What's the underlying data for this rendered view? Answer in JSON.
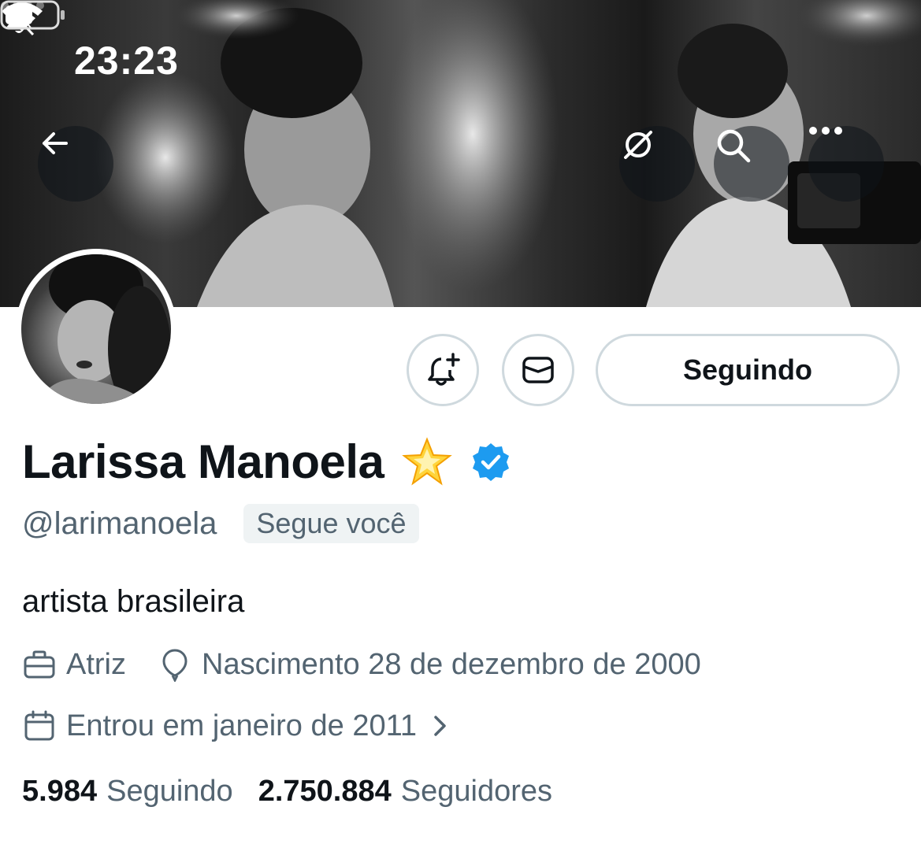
{
  "status_bar": {
    "time": "23:23",
    "icons": [
      "bell-muted-icon",
      "cellular-signal-icon",
      "wifi-icon",
      "battery-icon"
    ]
  },
  "nav": {
    "back_icon": "arrow-left-icon",
    "grok_icon": "grok-icon",
    "search_icon": "search-icon",
    "more_icon": "more-horizontal-icon"
  },
  "profile": {
    "name": "Larissa Manoela",
    "name_emoji": "glowing-star-icon",
    "verified_icon": "verified-badge-icon",
    "handle": "@larimanoela",
    "follows_you": "Segue você",
    "bio": "artista brasileira",
    "profession": "Atriz",
    "birth": "Nascimento 28 de dezembro de 2000",
    "joined": "Entrou em janeiro de 2011"
  },
  "actions": {
    "notify_icon": "bell-plus-icon",
    "message_icon": "envelope-icon",
    "following_label": "Seguindo"
  },
  "stats": {
    "following_count": "5.984",
    "following_label": "Seguindo",
    "followers_count": "2.750.884",
    "followers_label": "Seguidores"
  },
  "colors": {
    "text_primary": "#0f1419",
    "text_secondary": "#536471",
    "border": "#cfd9de",
    "verified": "#1d9bf0",
    "chip_bg": "#eff3f4"
  }
}
